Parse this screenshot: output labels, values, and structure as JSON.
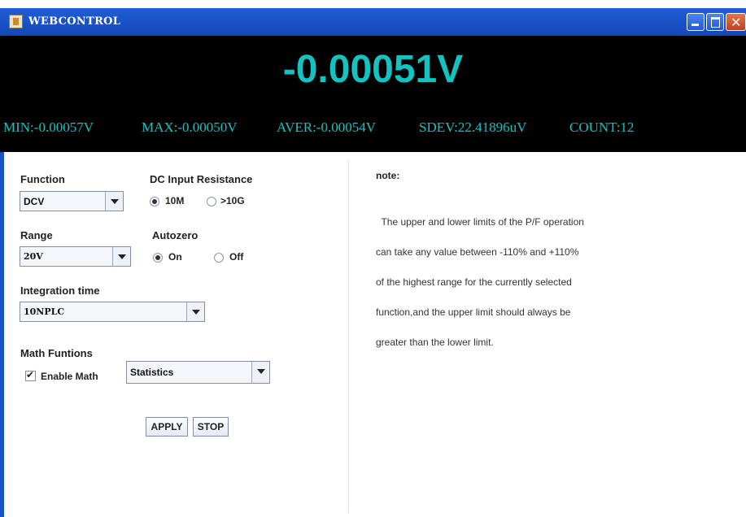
{
  "window": {
    "title": "WEBCONTROL"
  },
  "display": {
    "reading": "-0.00051V",
    "stats": {
      "min": "MIN:-0.00057V",
      "max": "MAX:-0.00050V",
      "aver": "AVER:-0.00054V",
      "sdev": "SDEV:22.41896uV",
      "count": "COUNT:12"
    },
    "text_color": "#14c3c1"
  },
  "controls": {
    "function": {
      "label": "Function",
      "value": "DCV"
    },
    "dc_input_resistance": {
      "label": "DC Input Resistance",
      "options": [
        "10M",
        ">10G"
      ],
      "selected": "10M"
    },
    "range": {
      "label": "Range",
      "value": "20V"
    },
    "autozero": {
      "label": "Autozero",
      "options": [
        "On",
        "Off"
      ],
      "selected": "On"
    },
    "integration_time": {
      "label": "Integration time",
      "value": "10NPLC"
    },
    "math": {
      "label": "Math Funtions",
      "enable_label": "Enable Math",
      "enabled": true,
      "value": "Statistics"
    },
    "buttons": {
      "apply": "APPLY",
      "stop": "STOP"
    }
  },
  "note": {
    "title": "note:",
    "lines": [
      "  The upper and lower limits of the P/F operation",
      "can take any value between -110% and +110%",
      "of the highest range for the currently selected",
      "function,and the upper limit should always be",
      "greater than the lower limit."
    ]
  },
  "icons": {
    "app": "java-coffee-icon",
    "minimize": "minimize-icon",
    "maximize": "maximize-icon",
    "close": "close-icon"
  }
}
